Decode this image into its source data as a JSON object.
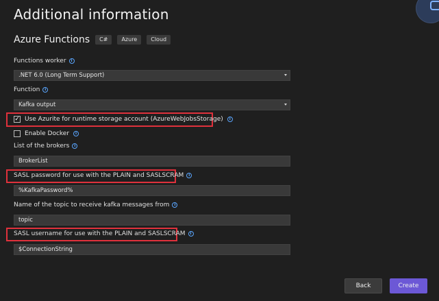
{
  "title": "Additional information",
  "subtitle": "Azure Functions",
  "tags": [
    "C#",
    "Azure",
    "Cloud"
  ],
  "functions_worker": {
    "label": "Functions worker",
    "value": ".NET 6.0 (Long Term Support)"
  },
  "function": {
    "label": "Function",
    "value": "Kafka output"
  },
  "use_azurite": {
    "label": "Use Azurite for runtime storage account (AzureWebJobsStorage)",
    "checked": true
  },
  "enable_docker": {
    "label": "Enable Docker",
    "checked": false
  },
  "brokers": {
    "label": "List of the brokers",
    "value": "BrokerList"
  },
  "sasl_password": {
    "label": "SASL password for use with the PLAIN and SASLSCRAM",
    "value": "%KafkaPassword%"
  },
  "topic": {
    "label": "Name of the topic to receive kafka messages from",
    "value": "topic"
  },
  "sasl_username": {
    "label": "SASL username for use with the PLAIN and SASLSCRAM",
    "value": "$ConnectionString"
  },
  "buttons": {
    "back": "Back",
    "create": "Create"
  },
  "icons": {
    "info": "info-icon",
    "dropdown": "chevron-down-icon",
    "corner": "feedback-icon"
  },
  "colors": {
    "background": "#1f1f1f",
    "accent": "#6c58d6",
    "highlight": "#e0313c",
    "info": "#5aa6ff"
  }
}
